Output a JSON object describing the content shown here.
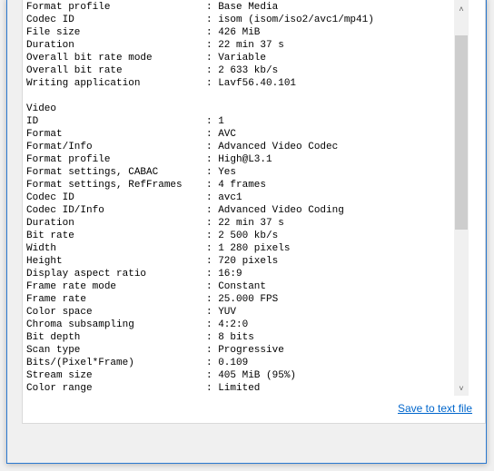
{
  "general": [
    {
      "label": "Format profile",
      "value": "Base Media"
    },
    {
      "label": "Codec ID",
      "value": "isom (isom/iso2/avc1/mp41)"
    },
    {
      "label": "File size",
      "value": "426 MiB"
    },
    {
      "label": "Duration",
      "value": "22 min 37 s"
    },
    {
      "label": "Overall bit rate mode",
      "value": "Variable"
    },
    {
      "label": "Overall bit rate",
      "value": "2 633 kb/s"
    },
    {
      "label": "Writing application",
      "value": "Lavf56.40.101"
    }
  ],
  "video_heading": "Video",
  "video": [
    {
      "label": "ID",
      "value": "1"
    },
    {
      "label": "Format",
      "value": "AVC"
    },
    {
      "label": "Format/Info",
      "value": "Advanced Video Codec"
    },
    {
      "label": "Format profile",
      "value": "High@L3.1"
    },
    {
      "label": "Format settings, CABAC",
      "value": "Yes"
    },
    {
      "label": "Format settings, RefFrames",
      "value": "4 frames"
    },
    {
      "label": "Codec ID",
      "value": "avc1"
    },
    {
      "label": "Codec ID/Info",
      "value": "Advanced Video Coding"
    },
    {
      "label": "Duration",
      "value": "22 min 37 s"
    },
    {
      "label": "Bit rate",
      "value": "2 500 kb/s"
    },
    {
      "label": "Width",
      "value": "1 280 pixels"
    },
    {
      "label": "Height",
      "value": "720 pixels"
    },
    {
      "label": "Display aspect ratio",
      "value": "16:9"
    },
    {
      "label": "Frame rate mode",
      "value": "Constant"
    },
    {
      "label": "Frame rate",
      "value": "25.000 FPS"
    },
    {
      "label": "Color space",
      "value": "YUV"
    },
    {
      "label": "Chroma subsampling",
      "value": "4:2:0"
    },
    {
      "label": "Bit depth",
      "value": "8 bits"
    },
    {
      "label": "Scan type",
      "value": "Progressive"
    },
    {
      "label": "Bits/(Pixel*Frame)",
      "value": "0.109"
    },
    {
      "label": "Stream size",
      "value": "405 MiB (95%)"
    },
    {
      "label": "Color range",
      "value": "Limited"
    }
  ],
  "separator": ": ",
  "scroll_up_icon": "chevron-up-icon",
  "scroll_down_icon": "chevron-down-icon",
  "save_link": "Save to text file",
  "colors": {
    "link": "#0066cc",
    "border": "#2b79d0"
  }
}
